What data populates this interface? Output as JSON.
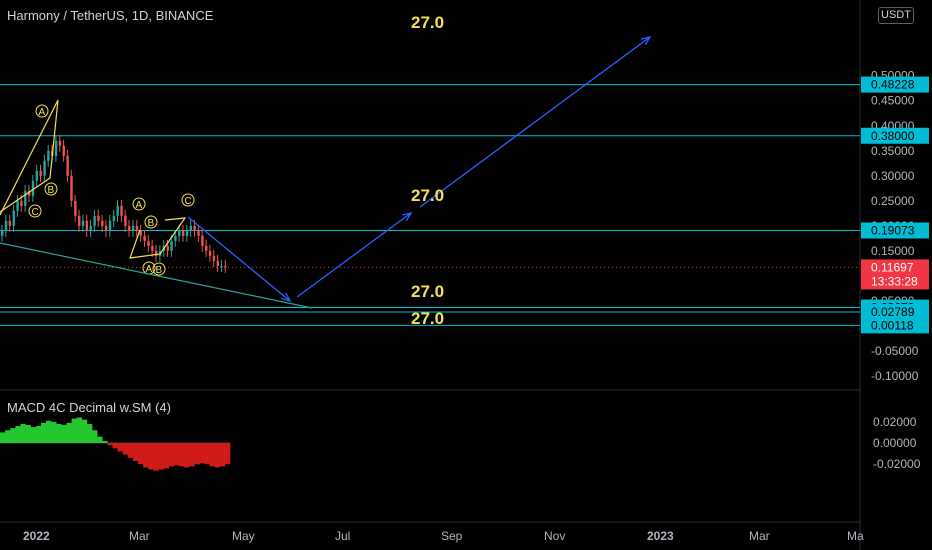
{
  "header": {
    "symbol_title": "Harmony / TetherUS, 1D, BINANCE",
    "currency": "USDT"
  },
  "macd": {
    "title": "MACD 4C Decimal w.SM (4)"
  },
  "colors": {
    "background": "#000000",
    "hline": "#00bcd4",
    "label_yellow": "#f5e05a",
    "arrow": "#2962ff",
    "wave": "#f5e05a",
    "current_price": "#f23645",
    "macd_green": "#26c631",
    "macd_red": "#d11a1a"
  },
  "chart_data": [
    {
      "type": "candlestick",
      "title": "Harmony / TetherUS, 1D, BINANCE",
      "x_ticks": [
        "2022",
        "Mar",
        "May",
        "Jul",
        "Sep",
        "Nov",
        "2023",
        "Mar",
        "Ma"
      ],
      "y_ticks": [
        "0.50000",
        "0.45000",
        "0.40000",
        "0.35000",
        "0.30000",
        "0.25000",
        "0.20000",
        "0.15000",
        "0.10000",
        "0.05000",
        "0.00000",
        "-0.05000",
        "-0.10000"
      ],
      "ylim": [
        -0.11,
        0.52
      ],
      "current_price": {
        "value": "0.11697",
        "countdown": "13:33:28"
      },
      "horizontal_levels": [
        {
          "value": 0.48228,
          "label": "0.48228"
        },
        {
          "value": 0.38,
          "label": "0.38000"
        },
        {
          "value": 0.19073,
          "label": "0.19073"
        },
        {
          "value": 0.03679,
          "label": "0.03679"
        },
        {
          "value": 0.02789,
          "label": "0.02789"
        },
        {
          "value": 0.00118,
          "label": "0.00118"
        }
      ],
      "annotations": [
        "27.0",
        "27.0",
        "27.0",
        "27.0"
      ],
      "wave_labels": [
        "A",
        "B",
        "C",
        "A",
        "B",
        "C",
        "A",
        "B"
      ]
    },
    {
      "type": "histogram",
      "title": "MACD 4C Decimal w.SM (4)",
      "y_ticks": [
        "0.02000",
        "0.00000",
        "-0.02000"
      ],
      "ylim": [
        -0.031,
        0.024
      ],
      "values": [
        0.01,
        0.012,
        0.014,
        0.016,
        0.018,
        0.017,
        0.015,
        0.016,
        0.019,
        0.021,
        0.02,
        0.018,
        0.017,
        0.019,
        0.023,
        0.024,
        0.022,
        0.018,
        0.012,
        0.006,
        0.002,
        -0.002,
        -0.005,
        -0.008,
        -0.011,
        -0.014,
        -0.017,
        -0.02,
        -0.023,
        -0.025,
        -0.026,
        -0.025,
        -0.024,
        -0.022,
        -0.021,
        -0.022,
        -0.023,
        -0.022,
        -0.02,
        -0.019,
        -0.02,
        -0.022,
        -0.023,
        -0.022,
        -0.02
      ]
    }
  ]
}
